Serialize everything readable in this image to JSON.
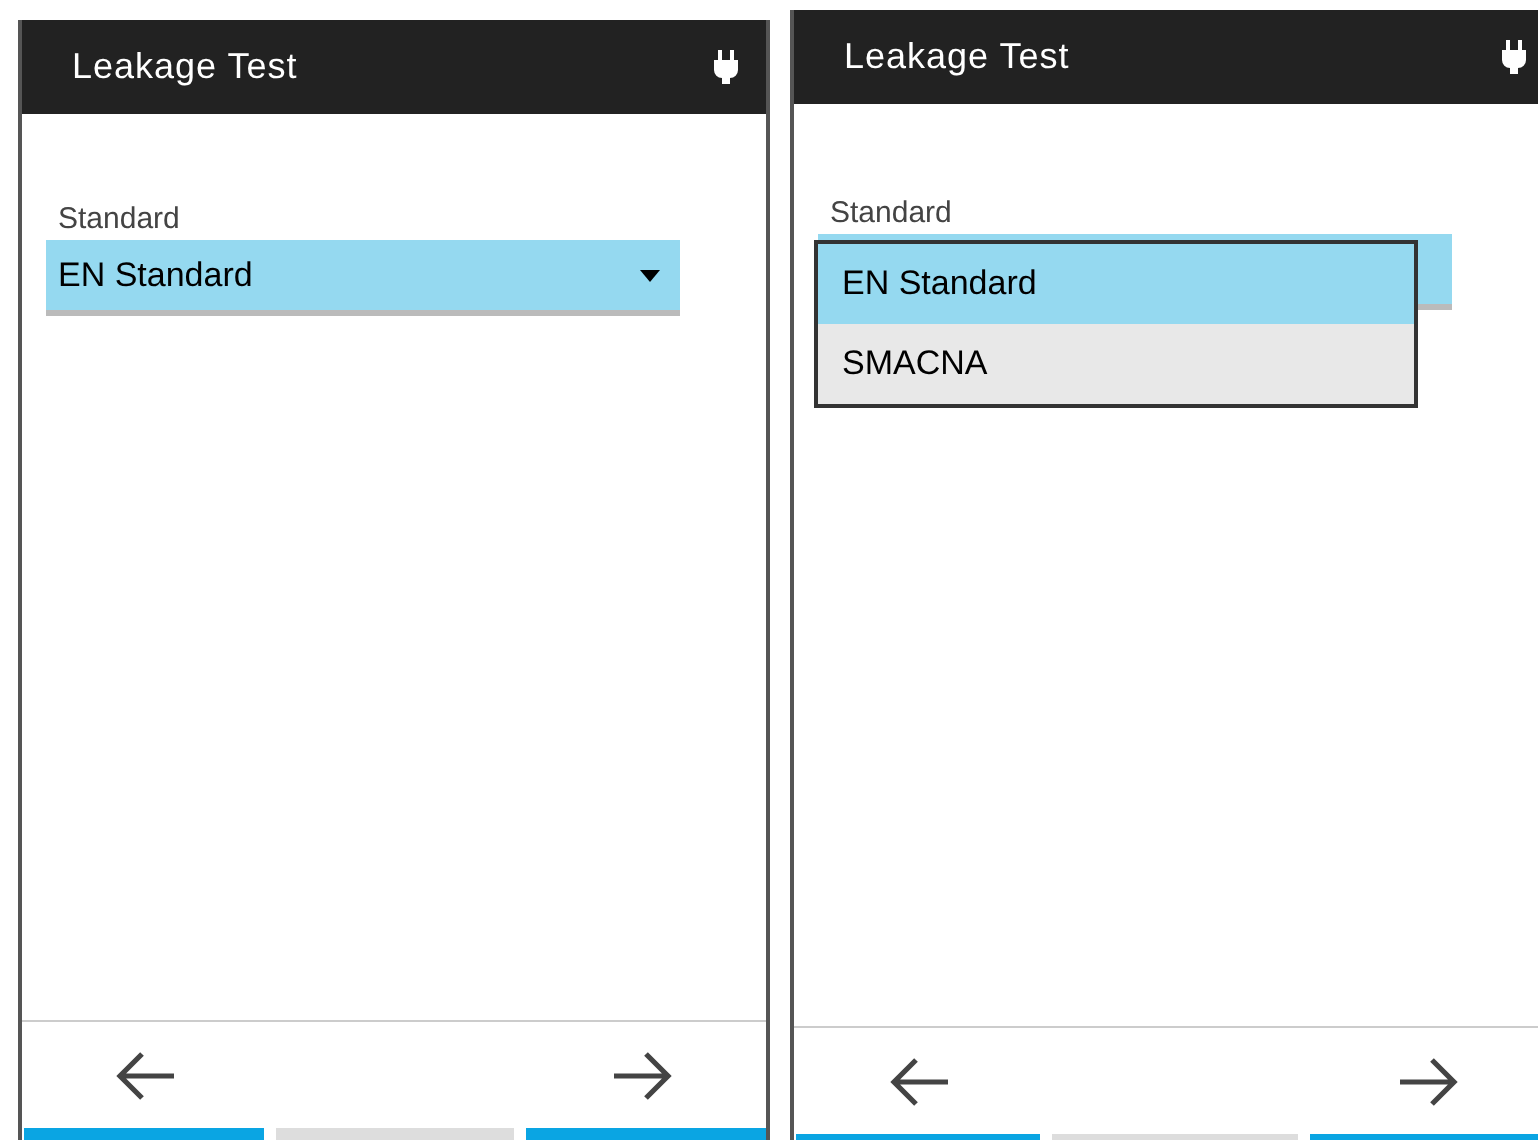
{
  "screens": [
    {
      "title": "Leakage Test",
      "field": {
        "label": "Standard",
        "value": "EN Standard",
        "open": false
      },
      "softkeys": [
        {
          "kind": "back",
          "active": true
        },
        {
          "kind": "none",
          "active": false
        },
        {
          "kind": "forward",
          "active": true
        }
      ]
    },
    {
      "title": "Leakage Test",
      "field": {
        "label": "Standard",
        "open": true,
        "options": [
          {
            "label": "EN Standard",
            "selected": true
          },
          {
            "label": "SMACNA",
            "selected": false
          }
        ]
      },
      "softkeys": [
        {
          "kind": "back",
          "active": true
        },
        {
          "kind": "none",
          "active": false
        },
        {
          "kind": "forward",
          "active": true
        }
      ]
    }
  ]
}
